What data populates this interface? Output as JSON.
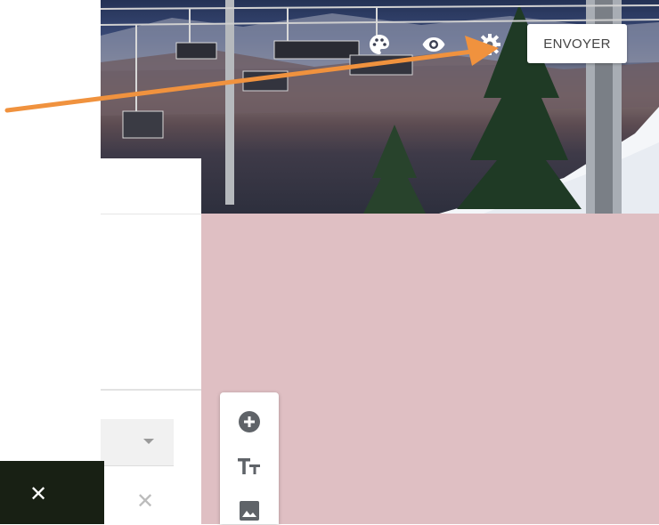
{
  "header": {
    "send_label": "ENVOYER",
    "icons": [
      "palette-icon",
      "eye-icon",
      "gear-icon"
    ]
  },
  "form": {
    "dropdown_value": "",
    "clear_icon": "close-icon"
  },
  "toolbar": {
    "items": [
      "add-circle-icon",
      "text-title-icon",
      "image-icon"
    ]
  },
  "snackbar": {
    "close_icon": "close-icon"
  },
  "colors": {
    "background_theme": "#dfbfc3",
    "annotation_arrow": "#f0923e",
    "snackbar_bg": "#182014"
  }
}
